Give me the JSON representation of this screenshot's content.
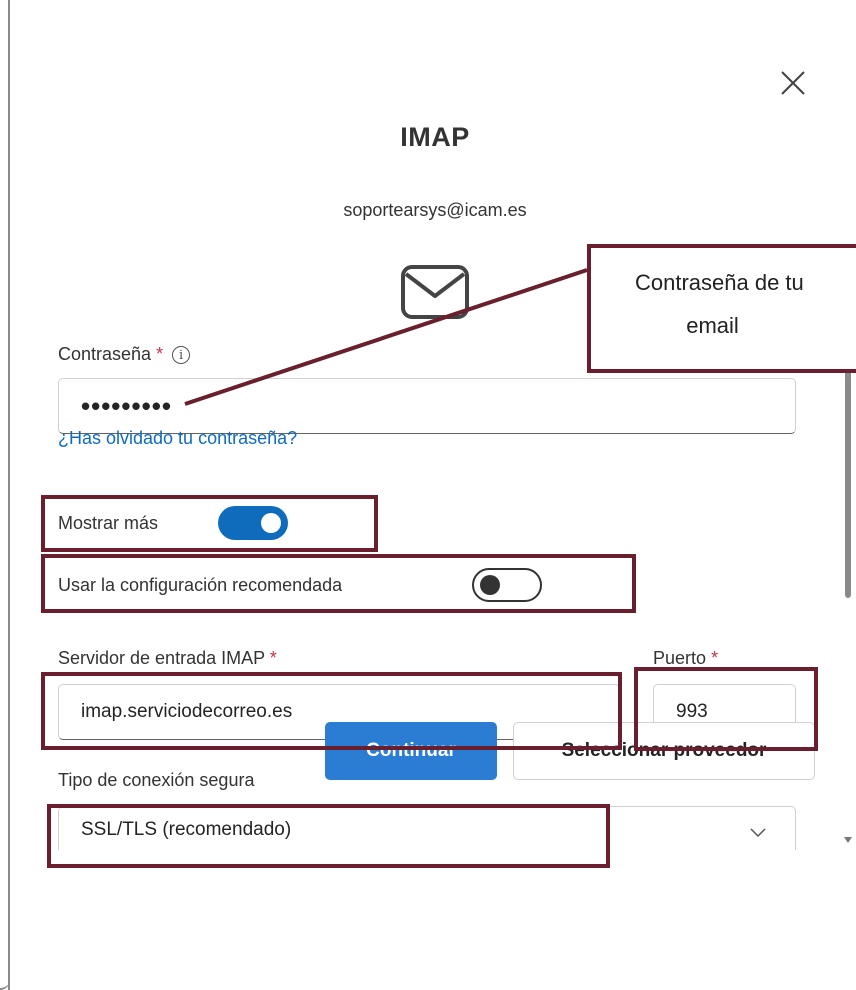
{
  "dialog": {
    "title": "IMAP",
    "email": "soportearsys@icam.es"
  },
  "password": {
    "label": "Contraseña",
    "required_mark": "*",
    "info_glyph": "i",
    "value_masked": "•••••••••"
  },
  "forgot_link": "¿Has olvidado tu contraseña?",
  "show_more": {
    "label": "Mostrar más",
    "on": true
  },
  "recommended_config": {
    "label": "Usar la configuración recomendada",
    "on": false
  },
  "imap_server": {
    "label": "Servidor de entrada IMAP",
    "required_mark": "*",
    "value": "imap.serviciodecorreo.es"
  },
  "port": {
    "label": "Puerto",
    "required_mark": "*",
    "value": "993"
  },
  "connection": {
    "label": "Tipo de conexión segura",
    "value": "SSL/TLS (recomendado)"
  },
  "buttons": {
    "continue": "Continuar",
    "select_provider": "Seleccionar proveedor"
  },
  "callout": {
    "line1": "Contraseña de tu",
    "line2": "email"
  },
  "colors": {
    "accent": "#0f6cbd",
    "primary_button": "#2b7cd3",
    "annotation": "#6a1f2e",
    "required": "#c4314b"
  },
  "icons": [
    "close-icon",
    "mail-icon",
    "info-icon",
    "chevron-down-icon"
  ]
}
